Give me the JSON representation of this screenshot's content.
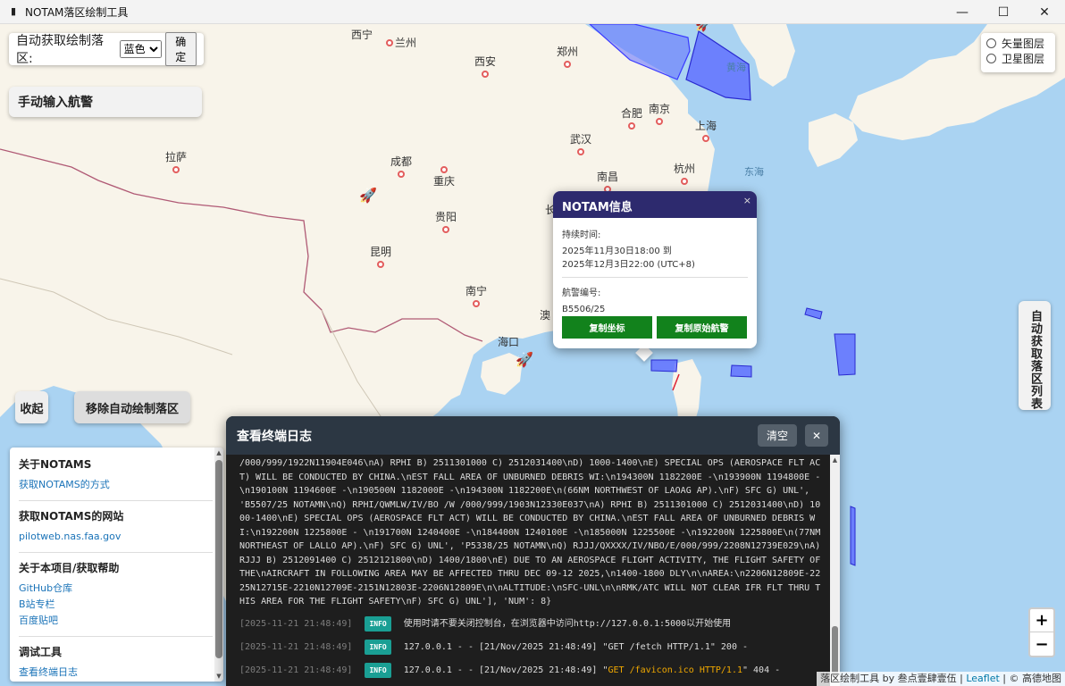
{
  "window": {
    "title": "NOTAM落区绘制工具",
    "icon": "launch-icon",
    "controls": {
      "minimize": "—",
      "maximize": "☐",
      "close": "✕"
    }
  },
  "auto_panel": {
    "label": "自动获取绘制落区:",
    "color_value": "蓝色",
    "confirm_label": "确定"
  },
  "manual_button": "手动输入航警",
  "layers": {
    "vector": "矢量图层",
    "satellite": "卫星图层"
  },
  "side_tab": "自动获取落区列表",
  "collapse_button": "收起",
  "remove_button": "移除自动绘制落区",
  "cities": [
    {
      "name": "西宁"
    },
    {
      "name": "兰州"
    },
    {
      "name": "西安"
    },
    {
      "name": "郑州"
    },
    {
      "name": "合肥"
    },
    {
      "name": "南京"
    },
    {
      "name": "上海"
    },
    {
      "name": "武汉"
    },
    {
      "name": "杭州"
    },
    {
      "name": "拉萨"
    },
    {
      "name": "成都"
    },
    {
      "name": "重庆"
    },
    {
      "name": "南昌"
    },
    {
      "name": "贵阳"
    },
    {
      "name": "昆明"
    },
    {
      "name": "南宁"
    },
    {
      "name": "海口"
    },
    {
      "name": "长"
    },
    {
      "name": "澳"
    }
  ],
  "seas": {
    "yellow": "黄海",
    "east": "东海"
  },
  "info_panel": {
    "sections": [
      {
        "heading": "关于NOTAMS",
        "links": [
          "获取NOTAMS的方式"
        ]
      },
      {
        "heading": "获取NOTAMS的网站",
        "links": [
          "pilotweb.nas.faa.gov"
        ]
      },
      {
        "heading": "关于本项目/获取帮助",
        "links": [
          "GitHub仓库",
          "B站专栏",
          "百度贴吧"
        ]
      },
      {
        "heading": "调试工具",
        "links": [
          "查看终端日志"
        ]
      }
    ]
  },
  "popup": {
    "title": "NOTAM信息",
    "close": "×",
    "duration_label": "持续时间:",
    "duration_start": "2025年11月30日18:00 到",
    "duration_end": "2025年12月3日22:00 (UTC+8)",
    "id_label": "航警编号:",
    "id_value": "B5506/25",
    "copy_coords": "复制坐标",
    "copy_raw": "复制原始航警"
  },
  "terminal": {
    "title": "查看终端日志",
    "clear_label": "清空",
    "close_label": "✕",
    "output": "/000/999/1922N11904E046\\nA) RPHI B) 2511301000 C) 2512031400\\nD) 1000-1400\\nE) SPECIAL OPS (AEROSPACE FLT ACT) WILL BE CONDUCTED BY CHINA.\\nEST FALL AREA OF UNBURNED DEBRIS WI:\\n194300N 1182200E -\\n193900N 1194800E -\\n190100N 1194600E -\\n190500N 1182000E -\\n194300N 1182200E\\n(66NM NORTHWEST OF LAOAG AP).\\nF) SFC G) UNL', 'B5507/25 NOTAMN\\nQ) RPHI/QWMLW/IV/BO /W /000/999/1903N12330E037\\nA) RPHI B) 2511301000 C) 2512031400\\nD) 1000-1400\\nE) SPECIAL OPS (AEROSPACE FLT ACT) WILL BE CONDUCTED BY CHINA.\\nEST FALL AREA OF UNBURNED DEBRIS WI:\\n192200N 1225800E - \\n191700N 1240400E -\\n184400N 1240100E -\\n185000N 1225500E -\\n192200N 1225800E\\n(77NM NORTHEAST OF LALLO AP).\\nF) SFC G) UNL', 'P5338/25 NOTAMN\\nQ) RJJJ/QXXXX/IV/NBO/E/000/999/2208N12739E029\\nA) RJJJ B) 2512091400 C) 2512121800\\nD) 1400/1800\\nE) DUE TO AN AEROSPACE FLIGHT ACTIVITY, THE FLIGHT SAFETY OF THE\\nAIRCRAFT IN FOLLOWING AREA MAY BE AFFECTED THRU DEC 09-12 2025,\\n1400-1800 DLY\\n\\nAREA:\\n2206N12809E-2225N12715E-2210N12709E-2151N12803E-2206N12809E\\n\\nALTITUDE:\\nSFC-UNL\\n\\nRMK/ATC WILL NOT CLEAR IFR FLT THRU THIS AREA FOR THE FLIGHT SAFETY\\nF) SFC G) UNL'], 'NUM': 8}",
    "logs": [
      {
        "ts": "[2025-11-21 21:48:49]",
        "level": "INFO",
        "msg": "使用时请不要关闭控制台，在浏览器中访问http://127.0.0.1:5000以开始使用",
        "hl": ""
      },
      {
        "ts": "[2025-11-21 21:48:49]",
        "level": "INFO",
        "msg": "127.0.0.1 - - [21/Nov/2025 21:48:49] \"GET /fetch HTTP/1.1\" 200 -",
        "hl": ""
      },
      {
        "ts": "[2025-11-21 21:48:49]",
        "level": "INFO",
        "msg_pre": "127.0.0.1 - - [21/Nov/2025 21:48:49] \"",
        "hl": "GET /favicon.ico HTTP/1.1",
        "msg_post": "\" 404 -"
      }
    ]
  },
  "zoom": {
    "in": "+",
    "out": "−"
  },
  "attribution": {
    "prefix": "落区绘制工具 by 叁点壹肆壹伍 |",
    "leaflet": "Leaflet",
    "suffix": "| © 高德地图"
  },
  "colors": {
    "polygon": "#5d6cff",
    "popup_header": "#2d2a6e",
    "button_green": "#12821c",
    "terminal_bg": "#1e1e1e",
    "info_badge": "#1a9f94"
  }
}
